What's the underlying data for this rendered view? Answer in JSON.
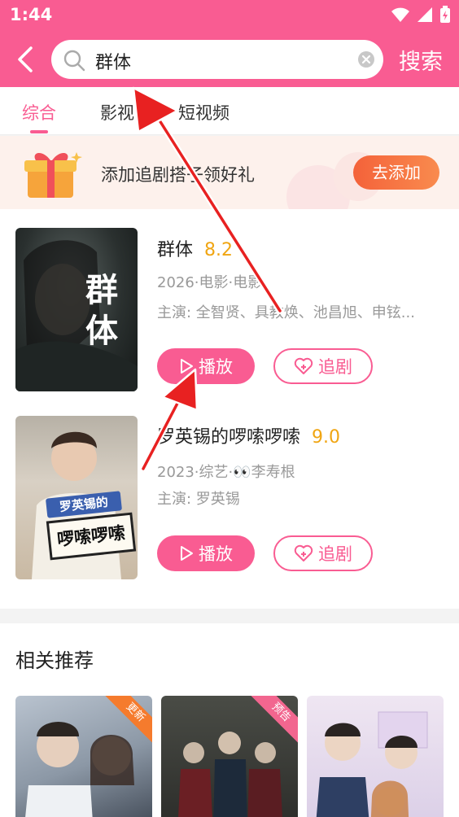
{
  "status_bar": {
    "time": "1:44"
  },
  "header": {
    "search_query": "群体",
    "search_button": "搜索"
  },
  "tabs": [
    {
      "label": "综合",
      "active": true
    },
    {
      "label": "影视",
      "active": false
    },
    {
      "label": "短视频",
      "active": false
    }
  ],
  "banner": {
    "text": "添加追剧搭子领好礼",
    "cta": "去添加"
  },
  "results": [
    {
      "title": "群体",
      "score": "8.2",
      "meta": "2026·电影·电影",
      "cast": "主演: 全智贤、具教焕、池昌旭、申铉...",
      "poster_text": "群\n体",
      "play_label": "播放",
      "follow_label": "追剧"
    },
    {
      "title": "罗英锡的啰嗦啰嗦",
      "score": "9.0",
      "meta": "2023·综艺·👀李寿根",
      "cast": "主演: 罗英锡",
      "poster_text_top": "罗英锡的",
      "poster_text_bottom": "啰嗦啰嗦",
      "play_label": "播放",
      "follow_label": "追剧"
    }
  ],
  "recommendations": {
    "title": "相关推荐",
    "items": [
      {
        "badge": "更新",
        "badge_color": "#f57b2d"
      },
      {
        "badge": "预告",
        "badge_color": "#f2668f"
      },
      {
        "badge": "",
        "badge_color": ""
      }
    ]
  },
  "colors": {
    "brand": "#f95c92",
    "score": "#f0a512",
    "cta": "#f4623a"
  }
}
